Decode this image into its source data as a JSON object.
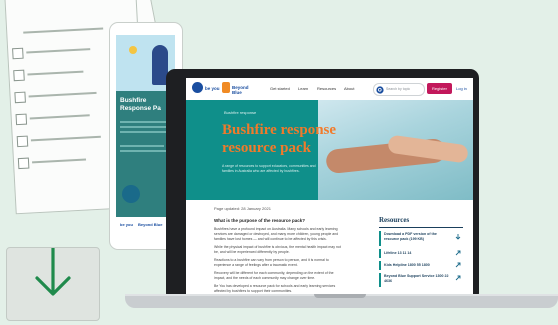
{
  "tablet": {
    "title": "Bushfire Response Pa",
    "brand": {
      "by_you": "be you",
      "beyond_blue": "Beyond Blue"
    }
  },
  "site": {
    "logo": {
      "by_you": "be you",
      "beyond_blue": "Beyond Blue"
    },
    "nav": [
      "Get started",
      "Learn",
      "Resources",
      "About"
    ],
    "search_placeholder": "Search by topic",
    "register": "Register",
    "login": "Log in"
  },
  "hero": {
    "breadcrumb": "Bushfire response",
    "title_line1": "Bushfire response",
    "title_line2": "resource pack",
    "intro": "A range of resources to support educators, communities and families in Australia who are affected by bushfires."
  },
  "article": {
    "date": "Page updated: 28 January 2021",
    "question": "What is the purpose of the resource pack?",
    "p1": "Bushfires have a profound impact on Australia. Many schools and early learning services are damaged or destroyed, and many more children, young people and families have lost homes — and will continue to be affected by this crisis.",
    "p2": "While the physical impact of bushfire is obvious, the mental health impact may not be, and will be experienced differently by people.",
    "p3": "Reactions to a bushfire can vary from person to person, and it is normal to experience a range of feelings after a traumatic event.",
    "p4": "Recovery will be different for each community, depending on the extent of the impact, and the needs of each community may change over time.",
    "p5": "Be You has developed a resource pack for schools and early learning services affected by bushfires to support their communities."
  },
  "resources": {
    "heading": "Resources",
    "items": [
      "Download a PDF version of the resource pack (199 KB)",
      "Lifeline 13 11 14",
      "Kids Helpline 1800 55 1800",
      "Beyond Blue Support Service 1300 22 4636"
    ]
  },
  "colors": {
    "background": "#e3f0e8",
    "teal": "#0f8f8a",
    "hero_title": "#f27a2a",
    "register": "#c2185b",
    "download_arrow": "#1f8a4c"
  },
  "icons": [
    "download-arrow-icon",
    "search-icon",
    "download-icon",
    "link-icon",
    "sun-icon"
  ]
}
